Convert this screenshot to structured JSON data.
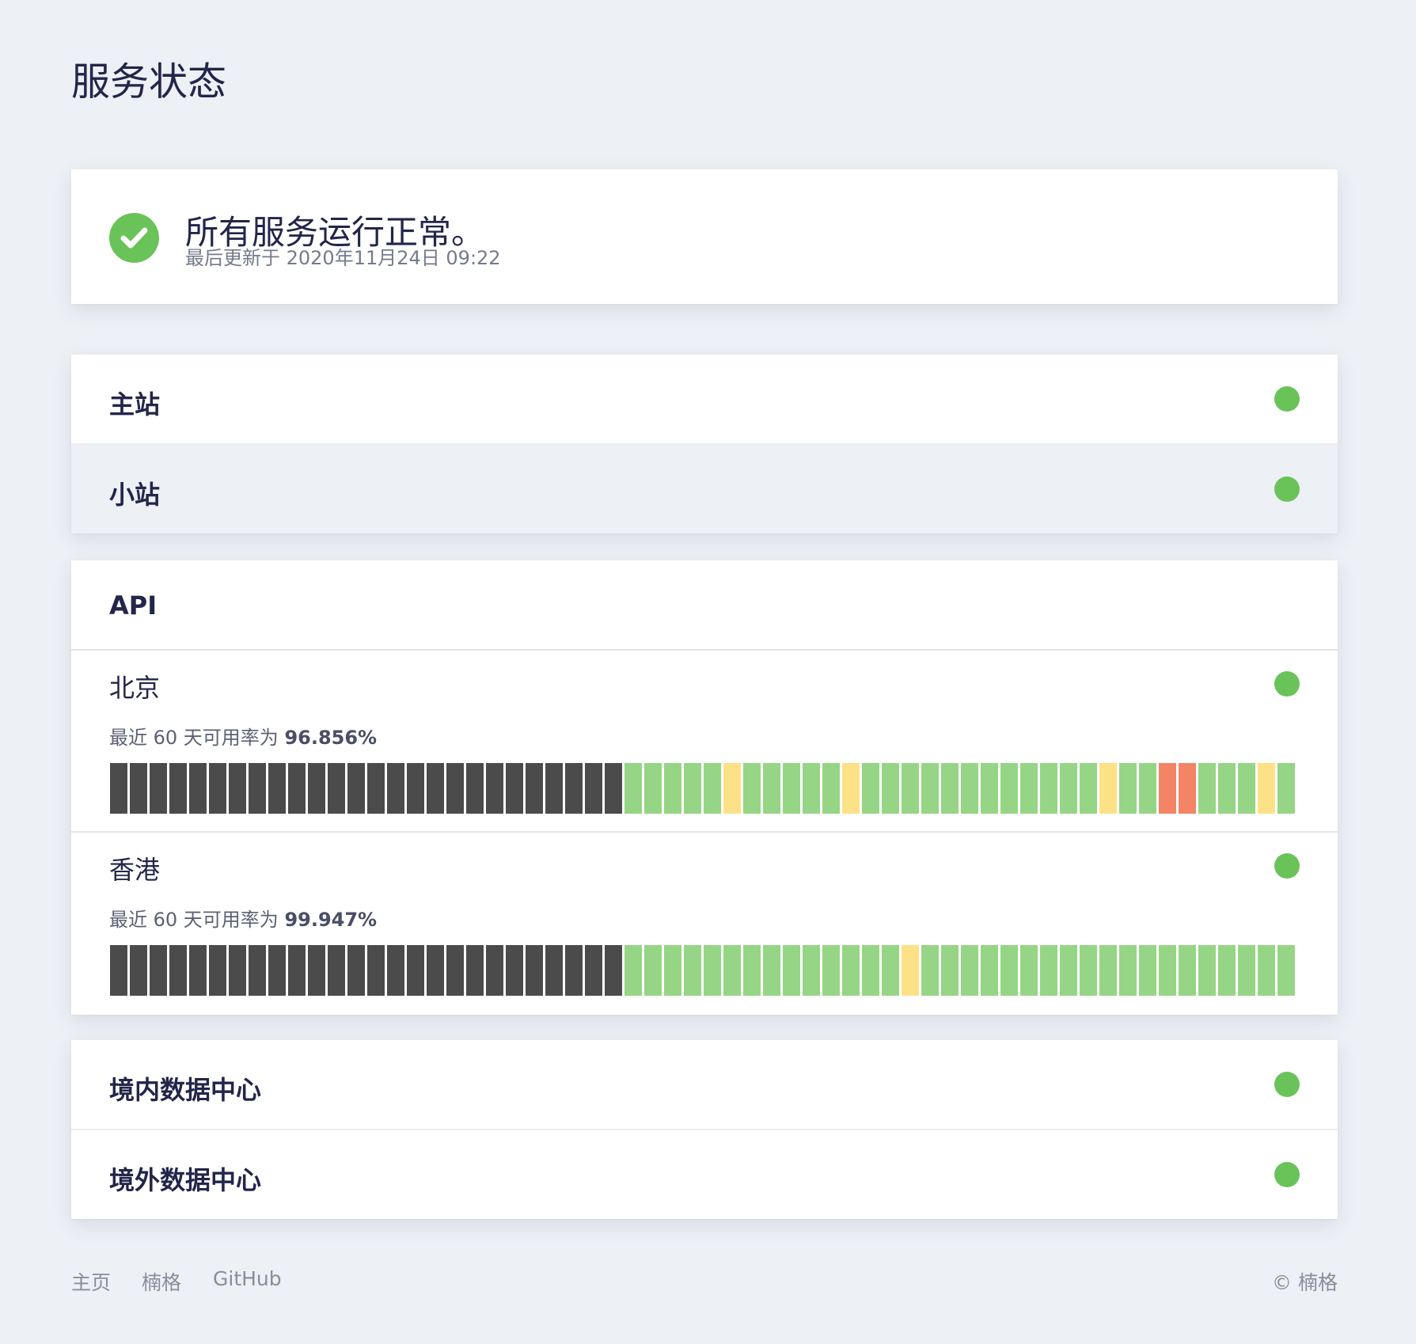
{
  "page": {
    "title": "服务状态"
  },
  "summary": {
    "title": "所有服务运行正常。",
    "updated": "最后更新于 2020年11月24日 09:22",
    "status_color": "#6ac359"
  },
  "groups": {
    "sites": {
      "rows": [
        {
          "label": "主站",
          "status": "operational"
        },
        {
          "label": "小站",
          "status": "operational"
        }
      ]
    },
    "api": {
      "label": "API",
      "regions": [
        {
          "label": "北京",
          "status": "operational",
          "uptime_prefix": "最近 60 天可用率为 ",
          "uptime_value": "96.856%",
          "days": [
            "none",
            "none",
            "none",
            "none",
            "none",
            "none",
            "none",
            "none",
            "none",
            "none",
            "none",
            "none",
            "none",
            "none",
            "none",
            "none",
            "none",
            "none",
            "none",
            "none",
            "none",
            "none",
            "none",
            "none",
            "none",
            "none",
            "up",
            "up",
            "up",
            "up",
            "up",
            "partial",
            "up",
            "up",
            "up",
            "up",
            "up",
            "partial",
            "up",
            "up",
            "up",
            "up",
            "up",
            "up",
            "up",
            "up",
            "up",
            "up",
            "up",
            "up",
            "partial",
            "up",
            "up",
            "down",
            "down",
            "up",
            "up",
            "up",
            "partial",
            "up"
          ]
        },
        {
          "label": "香港",
          "status": "operational",
          "uptime_prefix": "最近 60 天可用率为 ",
          "uptime_value": "99.947%",
          "days": [
            "none",
            "none",
            "none",
            "none",
            "none",
            "none",
            "none",
            "none",
            "none",
            "none",
            "none",
            "none",
            "none",
            "none",
            "none",
            "none",
            "none",
            "none",
            "none",
            "none",
            "none",
            "none",
            "none",
            "none",
            "none",
            "none",
            "up",
            "up",
            "up",
            "up",
            "up",
            "up",
            "up",
            "up",
            "up",
            "up",
            "up",
            "up",
            "up",
            "up",
            "partial",
            "up",
            "up",
            "up",
            "up",
            "up",
            "up",
            "up",
            "up",
            "up",
            "up",
            "up",
            "up",
            "up",
            "up",
            "up",
            "up",
            "up",
            "up",
            "up"
          ]
        }
      ]
    },
    "datacenters": {
      "rows": [
        {
          "label": "境内数据中心",
          "status": "operational"
        },
        {
          "label": "境外数据中心",
          "status": "operational"
        }
      ]
    }
  },
  "colors": {
    "operational": "#6ac359",
    "none": "#4b4b4b",
    "up": "#96d585",
    "partial": "#fde186",
    "down": "#f48466"
  },
  "footer": {
    "links": [
      "主页",
      "楠格",
      "GitHub"
    ],
    "copyright": "© 楠格"
  }
}
